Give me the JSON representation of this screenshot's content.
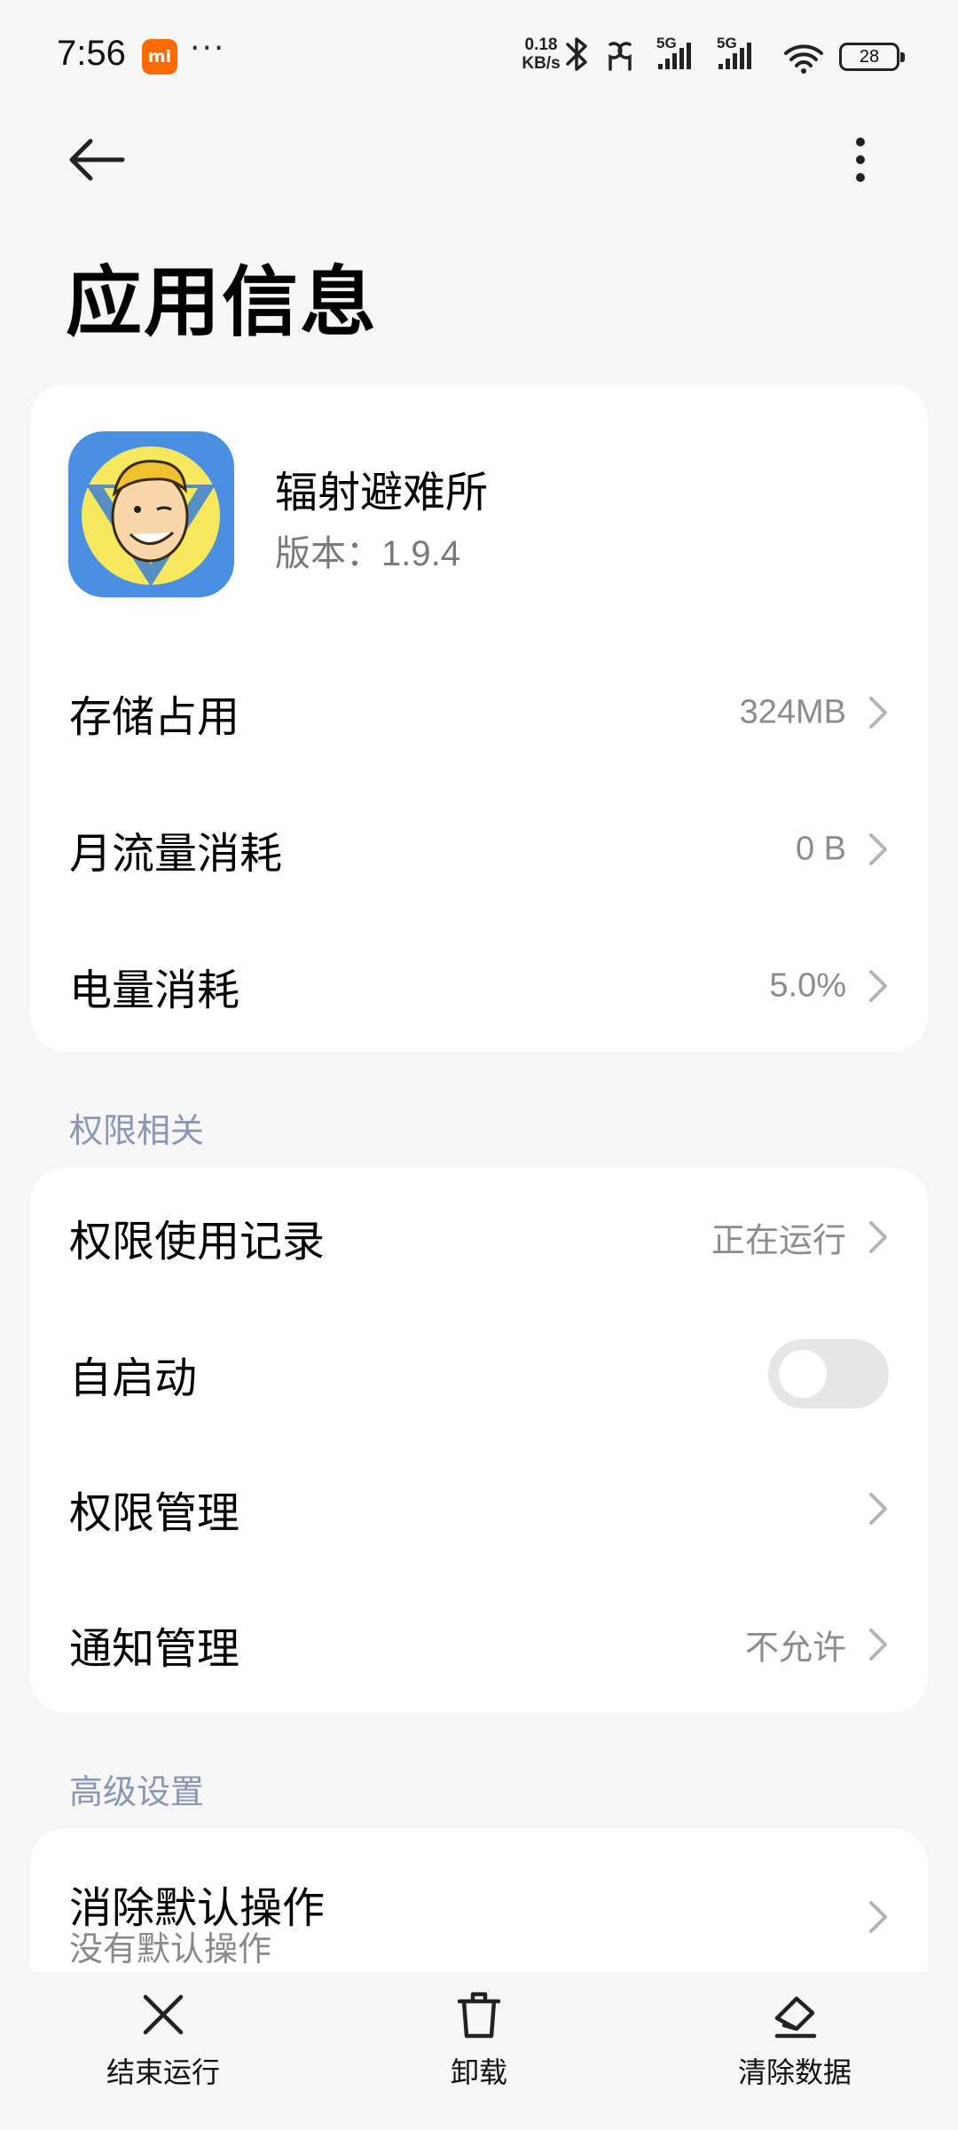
{
  "status_bar": {
    "time": "7:56",
    "mi_badge": "mi",
    "more": "···",
    "net_speed_value": "0.18",
    "net_speed_unit": "KB/s",
    "signal1_label": "5G",
    "signal2_label": "5G",
    "battery": "28"
  },
  "header": {
    "title": "应用信息"
  },
  "app": {
    "name": "辐射避难所",
    "version_label": "版本：",
    "version": "1.9.4"
  },
  "usage": {
    "rows": [
      {
        "label": "存储占用",
        "value": "324MB"
      },
      {
        "label": "月流量消耗",
        "value": "0 B"
      },
      {
        "label": "电量消耗",
        "value": "5.0%"
      }
    ]
  },
  "permissions": {
    "section_title": "权限相关",
    "usage_record": {
      "label": "权限使用记录",
      "value": "正在运行"
    },
    "autostart": {
      "label": "自启动",
      "enabled": false
    },
    "manage": {
      "label": "权限管理"
    },
    "notifications": {
      "label": "通知管理",
      "value": "不允许"
    }
  },
  "advanced": {
    "section_title": "高级设置",
    "clear_defaults": {
      "label": "消除默认操作",
      "sub": "没有默认操作"
    }
  },
  "bottom_bar": {
    "force_stop": "结束运行",
    "uninstall": "卸载",
    "clear_data": "清除数据"
  },
  "colors": {
    "background": "#f6f6f6",
    "card": "#ffffff",
    "section_title": "#8a96b4",
    "secondary_text": "#8c8c8c",
    "toggle_off": "#e6e6e6",
    "app_icon_bg": "#4a90e2"
  }
}
